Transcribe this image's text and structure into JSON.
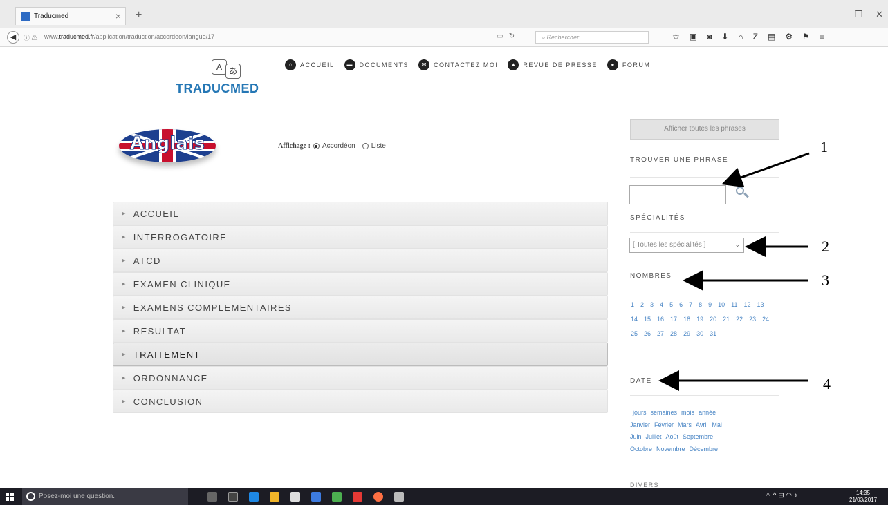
{
  "browser": {
    "tab_title": "Traducmed",
    "tab_close": "×",
    "new_tab": "+",
    "url_prefix": "www.",
    "url_domain": "traducmed.fr",
    "url_path": "/application/traduction/accordeon/langue/17",
    "search_placeholder": "Rechercher"
  },
  "header": {
    "logo_text": "TRADUCMED",
    "logo_glyph_a": "A",
    "logo_glyph_b": "あ",
    "nav": [
      {
        "label": "ACCUEIL"
      },
      {
        "label": "DOCUMENTS"
      },
      {
        "label": "CONTACTEZ MOI"
      },
      {
        "label": "REVUE DE PRESSE"
      },
      {
        "label": "FORUM"
      }
    ]
  },
  "language": {
    "badge_text": "Anglais",
    "display_label": "Affichage :",
    "option_accordion": "Accordéon",
    "option_list": "Liste",
    "selected": "Accordéon"
  },
  "accordion": {
    "items": [
      {
        "label": "ACCUEIL"
      },
      {
        "label": "INTERROGATOIRE"
      },
      {
        "label": "ATCD"
      },
      {
        "label": "EXAMEN CLINIQUE"
      },
      {
        "label": "EXAMENS COMPLEMENTAIRES"
      },
      {
        "label": "RESULTAT"
      },
      {
        "label": "TRAITEMENT"
      },
      {
        "label": "ORDONNANCE"
      },
      {
        "label": "CONCLUSION"
      }
    ],
    "active": "TRAITEMENT"
  },
  "sidebar": {
    "show_all_button": "Afficher toutes les phrases",
    "find_heading": "TROUVER UNE PHRASE",
    "specialties_heading": "SPÉCIALITÉS",
    "specialties_selected": "[ Toutes les spécialités ]",
    "numbers_heading": "NOMBRES",
    "numbers": [
      "1",
      "2",
      "3",
      "4",
      "5",
      "6",
      "7",
      "8",
      "9",
      "10",
      "11",
      "12",
      "13",
      "14",
      "15",
      "16",
      "17",
      "18",
      "19",
      "20",
      "21",
      "22",
      "23",
      "24",
      "25",
      "26",
      "27",
      "28",
      "29",
      "30",
      "31"
    ],
    "date_heading": "DATE",
    "date_units": [
      "jours",
      "semaines",
      "mois",
      "année"
    ],
    "months_row1": [
      "Janvier",
      "Février",
      "Mars",
      "Avril",
      "Mai"
    ],
    "months_row2": [
      "Juin",
      "Juillet",
      "Août",
      "Septembre"
    ],
    "months_row3": [
      "Octobre",
      "Novembre",
      "Décembre"
    ],
    "divers_heading": "DIVERS"
  },
  "annotations": [
    "1",
    "2",
    "3",
    "4"
  ],
  "taskbar": {
    "search_text": "Posez-moi une question.",
    "time": "14:35",
    "date": "21/03/2017"
  }
}
